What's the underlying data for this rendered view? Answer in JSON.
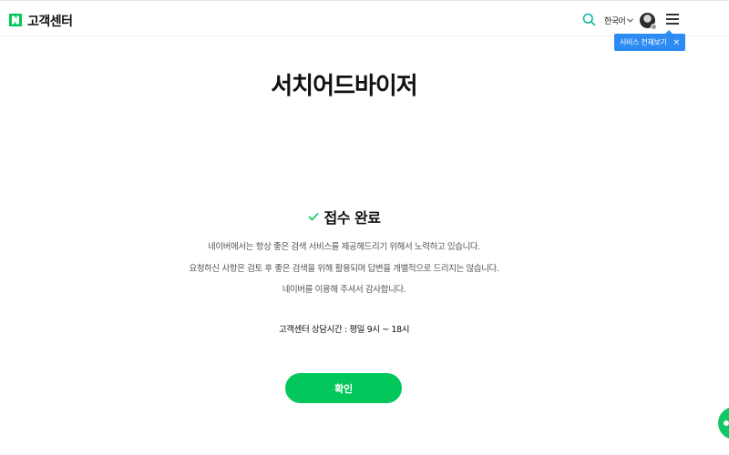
{
  "header": {
    "brand_logo_letter": "N",
    "brand": "고객센터",
    "language": "한국어",
    "tooltip": "서비스 전체보기",
    "tooltip_close": "×"
  },
  "main": {
    "title": "서치어드바이저",
    "status": "접수 완료",
    "descriptions": [
      "네이버에서는 항상 좋은 검색 서비스를 제공해드리기 위해서 노력하고 있습니다.",
      "요청하신 사항은 검토 후 좋은 검색을 위해 활용되며 답변을 개별적으로 드리지는 않습니다.",
      "네이버를 이용해 주셔서 감사합니다."
    ],
    "hours": "고객센터 상담시간 : 평일 9시 ~ 18시",
    "confirm_label": "확인"
  },
  "colors": {
    "brand_green": "#03c75a",
    "tooltip_blue": "#2c8cf4",
    "search_icon_teal": "#11b6a0"
  },
  "icons": [
    "naver-logo-icon",
    "search-icon",
    "chevron-down-icon",
    "avatar",
    "menu-icon",
    "check-icon",
    "chat-icon"
  ]
}
